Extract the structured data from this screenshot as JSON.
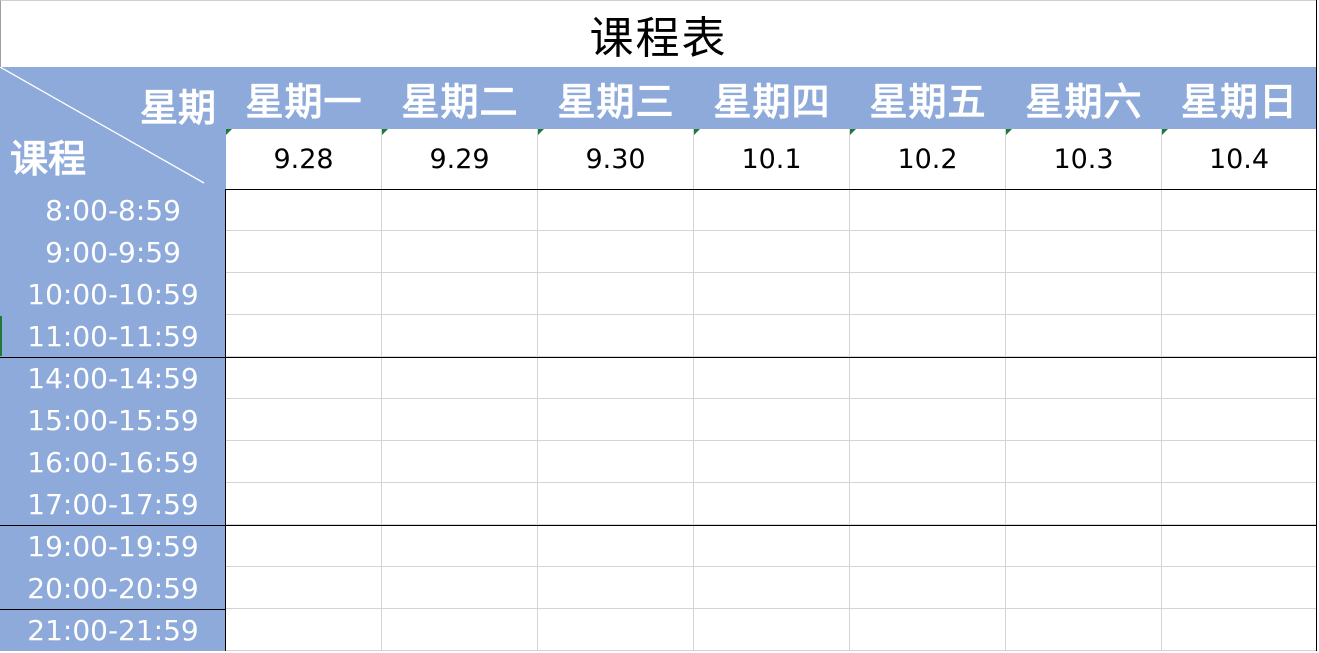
{
  "sheet": {
    "title": "课程表",
    "corner_top": "星期",
    "corner_bottom": "课程",
    "days": [
      "星期一",
      "星期二",
      "星期三",
      "星期四",
      "星期五",
      "星期六",
      "星期日"
    ],
    "dates": [
      "9.28",
      "9.29",
      "9.30",
      "10.1",
      "10.2",
      "10.3",
      "10.4"
    ],
    "times": [
      "8:00-8:59",
      "9:00-9:59",
      "10:00-10:59",
      "11:00-11:59",
      "14:00-14:59",
      "15:00-15:59",
      "16:00-16:59",
      "17:00-17:59",
      "19:00-19:59",
      "20:00-20:59",
      "21:00-21:59"
    ]
  },
  "colors": {
    "header_blue": "#8eaadb",
    "grid": "#d4d4d4",
    "marker_green": "#1f7a38"
  }
}
